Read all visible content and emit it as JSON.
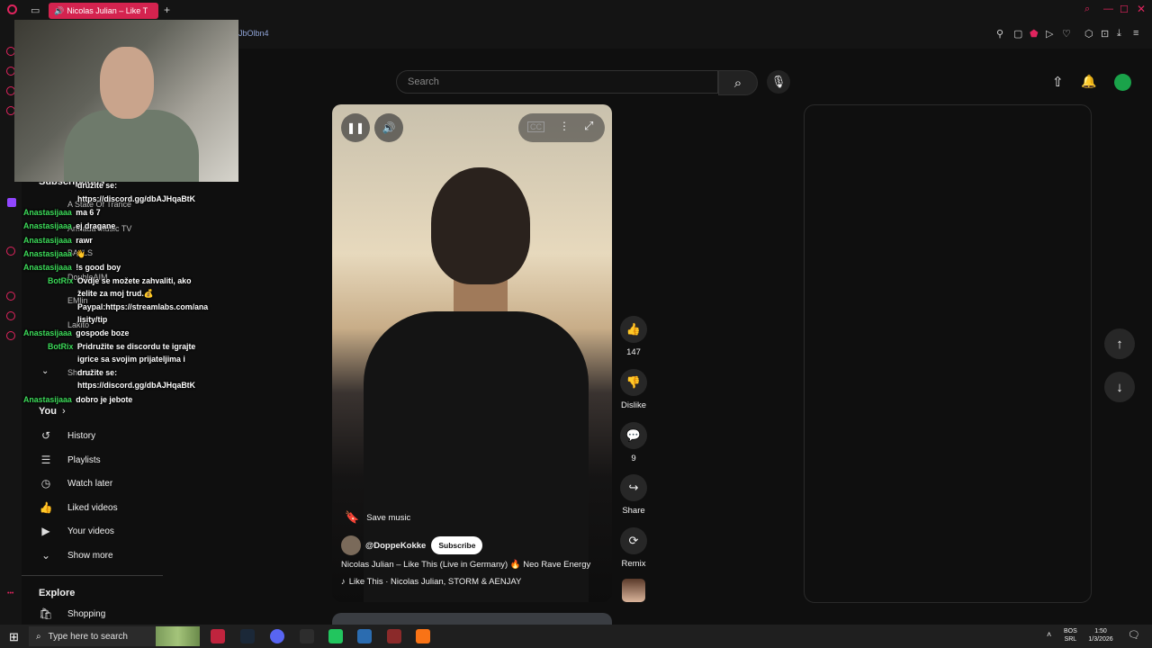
{
  "browser": {
    "tab_title": "Nicolas Julian – Like T",
    "url_fragment": "JbOlbn4"
  },
  "youtube": {
    "search_placeholder": "Search",
    "nav": {
      "subscriptions_label": "Subscriptions",
      "subscriptions": [
        "A State Of Trance",
        "Armada Music TV",
        "BALLS",
        "DoubleAIM",
        "EMlin",
        "Lakito",
        "Shorts"
      ],
      "show_fewer": "Show more",
      "you_label": "You",
      "you_items": [
        {
          "label": "History",
          "icon": "history-icon"
        },
        {
          "label": "Playlists",
          "icon": "playlist-icon"
        },
        {
          "label": "Watch later",
          "icon": "clock-icon"
        },
        {
          "label": "Liked videos",
          "icon": "thumb-up-icon"
        },
        {
          "label": "Your videos",
          "icon": "play-square-icon"
        },
        {
          "label": "Show more",
          "icon": "chevron-down-icon"
        }
      ],
      "explore_label": "Explore",
      "explore_items": [
        {
          "label": "Shopping",
          "icon": "bag-icon"
        }
      ]
    },
    "short": {
      "save_music": "Save music",
      "channel": "@DoppeKokke",
      "subscribe": "Subscribe",
      "title": "Nicolas Julian – Like This (Live in Germany) 🔥 Neo Rave Energy",
      "music": "Like This · Nicolas Julian, STORM & AENJAY"
    },
    "actions": {
      "likes": "147",
      "dislike": "Dislike",
      "comments": "9",
      "share": "Share",
      "remix": "Remix"
    }
  },
  "chat": [
    {
      "user": "",
      "text": "družite se:"
    },
    {
      "user": "",
      "text": "https://discord.gg/dbAJHqaBtK"
    },
    {
      "user": "Anastasijaaa",
      "text": "ma 6 7"
    },
    {
      "user": "Anastasijaaa",
      "text": "ej dragane"
    },
    {
      "user": "Anastasijaaa",
      "text": "rawr"
    },
    {
      "user": "Anastasijaaa",
      "text": "👋"
    },
    {
      "user": "Anastasijaaa",
      "text": "!s good boy"
    },
    {
      "user": "BotRix",
      "text": "Ovdje se možete zahvaliti, ako"
    },
    {
      "user": "",
      "text": "želite za moj trud.💰"
    },
    {
      "user": "",
      "text": "Paypal:https://streamlabs.com/ana"
    },
    {
      "user": "",
      "text": "lisity/tip"
    },
    {
      "user": "Anastasijaaa",
      "text": "gospode boze"
    },
    {
      "user": "BotRix",
      "text": "Pridružite se discordu te igrajte"
    },
    {
      "user": "",
      "text": "igrice sa svojim prijateljima i"
    },
    {
      "user": "",
      "text": "družite se:"
    },
    {
      "user": "",
      "text": "https://discord.gg/dbAJHqaBtK"
    },
    {
      "user": "Anastasijaaa",
      "text": "dobro je jebote"
    }
  ],
  "taskbar": {
    "search_placeholder": "Type here to search",
    "lang_top": "BOS",
    "lang_bottom": "SRL",
    "time": "1:50",
    "date": "1/3/2026"
  },
  "colors": {
    "accent": "#d4234f",
    "chat_user": "#3ddc5a",
    "avatar": "#1aa34a"
  }
}
